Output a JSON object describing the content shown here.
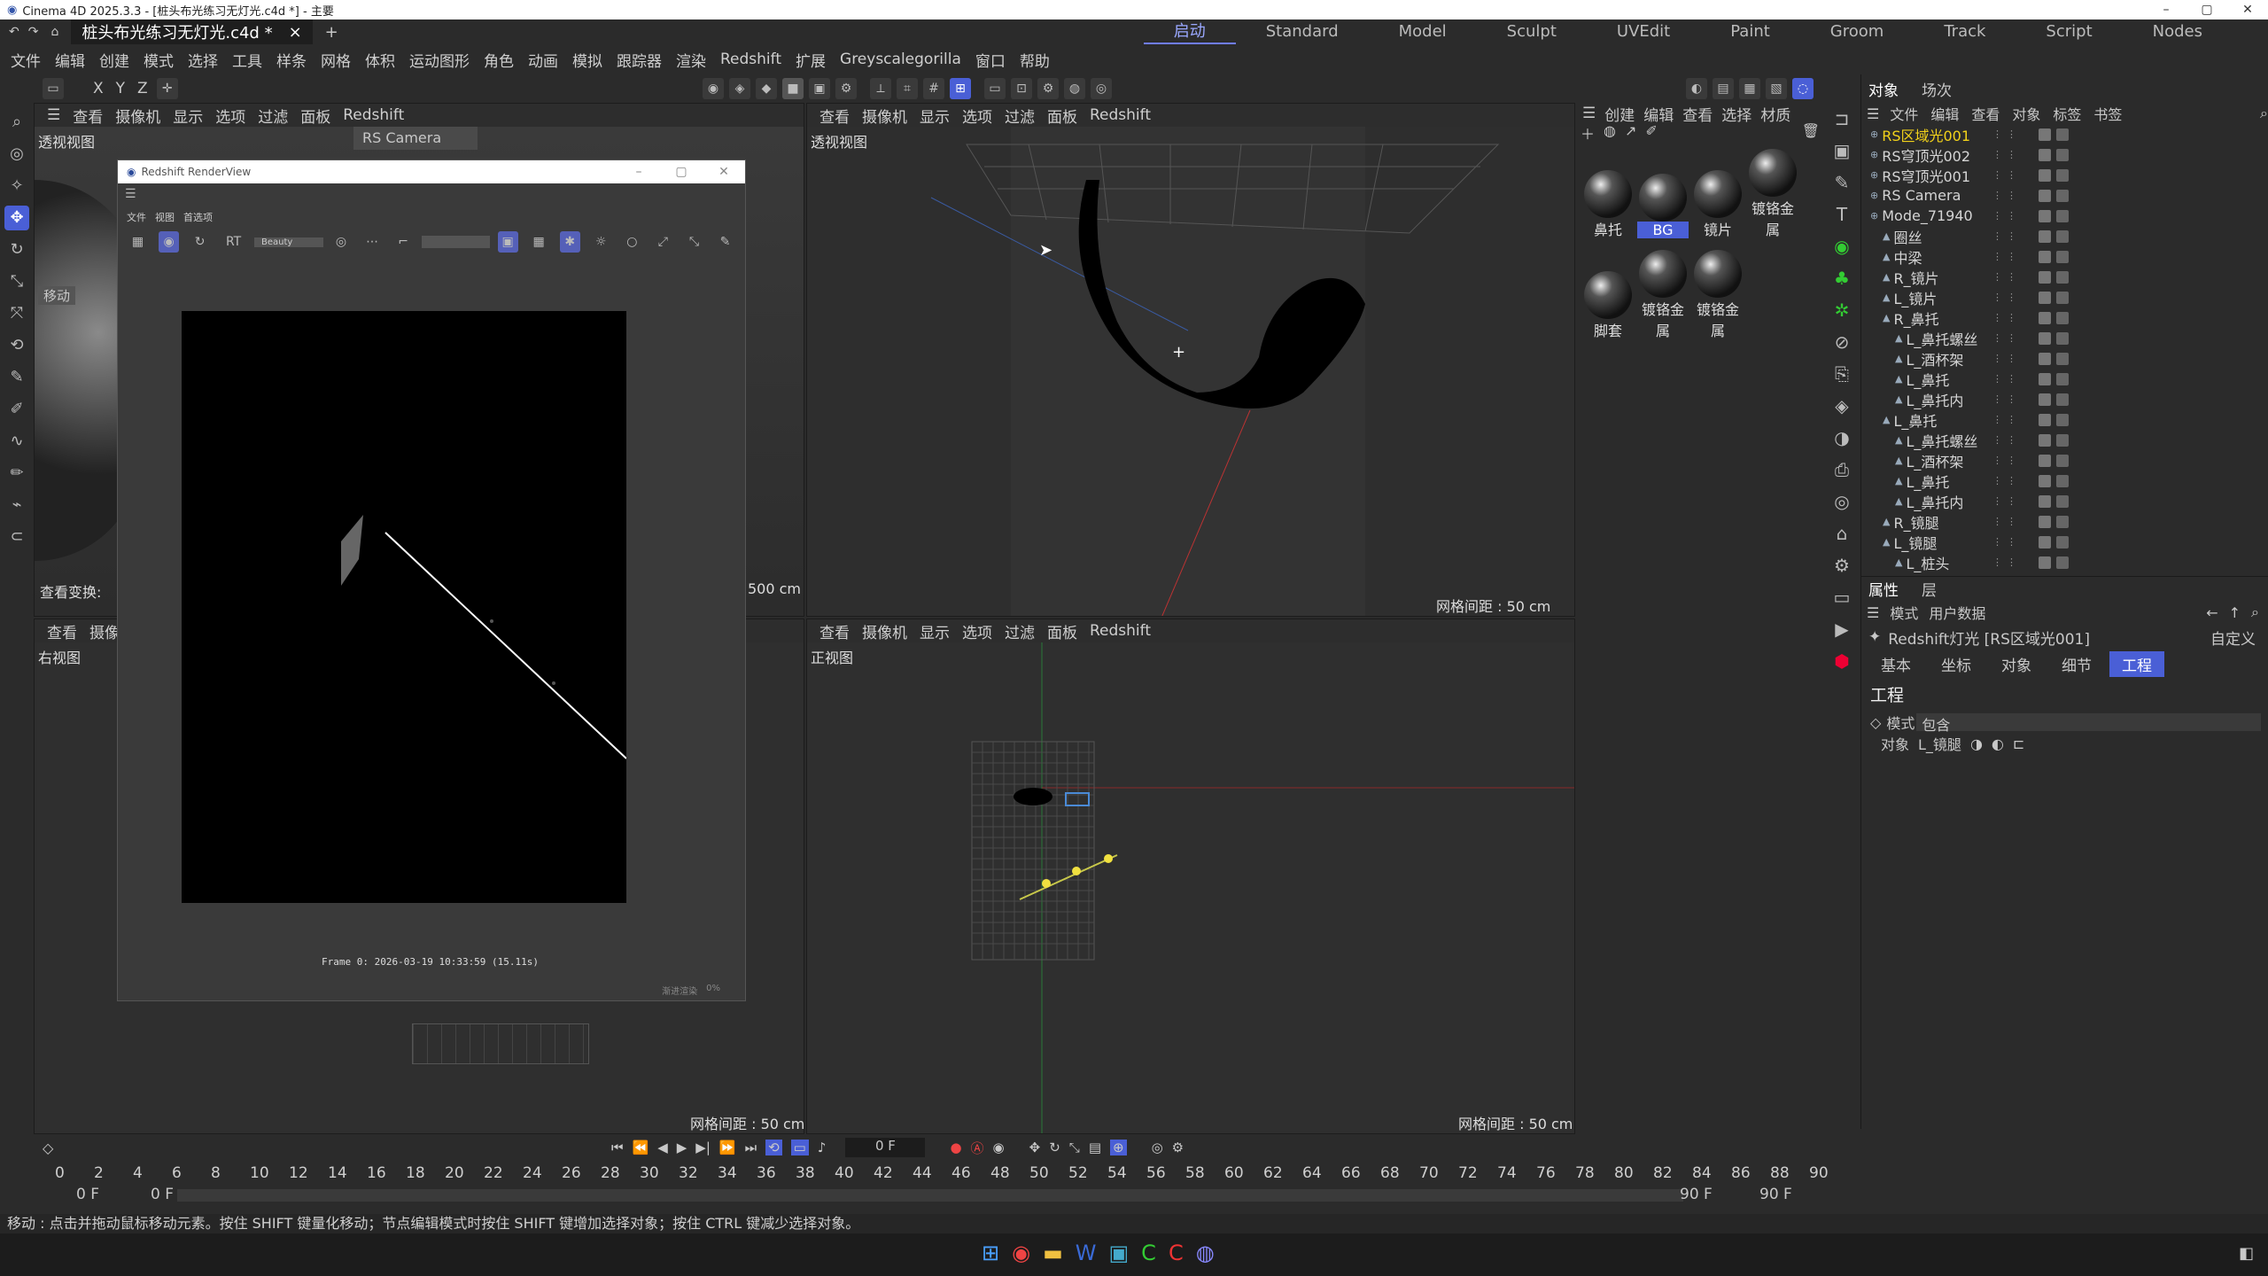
{
  "window": {
    "title": "Cinema 4D 2025.3.3 - [桩头布光练习无灯光.c4d *] - 主要"
  },
  "doc_tab": {
    "name": "桩头布光练习无灯光.c4d *",
    "close": "×",
    "add": "+"
  },
  "layouts": [
    "启动",
    "Standard",
    "Model",
    "Sculpt",
    "UVEdit",
    "Paint",
    "Groom",
    "Track",
    "Script",
    "Nodes"
  ],
  "active_layout": "启动",
  "menu": [
    "文件",
    "编辑",
    "创建",
    "模式",
    "选择",
    "工具",
    "样条",
    "网格",
    "体积",
    "运动图形",
    "角色",
    "动画",
    "模拟",
    "跟踪器",
    "渲染",
    "Redshift",
    "扩展",
    "Greyscalegorilla",
    "窗口",
    "帮助"
  ],
  "toolbar_axes": [
    "X",
    "Y",
    "Z"
  ],
  "viewport_menu": [
    "查看",
    "摄像机",
    "显示",
    "选项",
    "过滤",
    "面板",
    "Redshift"
  ],
  "viewports": {
    "tl": {
      "label": "透视视图",
      "camera": "RS Camera",
      "grid": "500 cm",
      "note": "查看变换:"
    },
    "tr": {
      "label": "透视视图",
      "grid": "网格间距 : 50 cm"
    },
    "bl": {
      "label": "右视图",
      "menu_left": "查看",
      "menu_left2": "摄像",
      "grid": "网格间距 : 50 cm"
    },
    "br": {
      "label": "正视图",
      "grid": "网格间距 : 50 cm"
    },
    "move_label": "移动"
  },
  "render_view": {
    "title": "Redshift RenderView",
    "menu": [
      "文件",
      "视图",
      "首选项"
    ],
    "aov": "Beauty",
    "status": "Frame  0:  2026-03-19  10:33:59  (15.11s)",
    "bottom": "渐进渲染",
    "bottom_pct": "0%"
  },
  "material_panel": {
    "menu": [
      "创建",
      "编辑",
      "查看",
      "选择",
      "材质"
    ],
    "materials": [
      "鼻托",
      "BG",
      "镜片",
      "镀铬金属",
      "脚套",
      "镀铬金属",
      "镀铬金属"
    ]
  },
  "objects_panel": {
    "tabs": [
      "对象",
      "场次"
    ],
    "menu": [
      "文件",
      "编辑",
      "查看",
      "对象",
      "标签",
      "书签"
    ],
    "rows": [
      {
        "name": "RS区域光001",
        "indent": 0,
        "selected": true
      },
      {
        "name": "RS穹顶光002",
        "indent": 0
      },
      {
        "name": "RS穹顶光001",
        "indent": 0
      },
      {
        "name": "RS Camera",
        "indent": 0
      },
      {
        "name": "Mode_71940",
        "indent": 0
      },
      {
        "name": "圈丝",
        "indent": 1
      },
      {
        "name": "中梁",
        "indent": 1
      },
      {
        "name": "R_镜片",
        "indent": 1
      },
      {
        "name": "L_镜片",
        "indent": 1
      },
      {
        "name": "R_鼻托",
        "indent": 1
      },
      {
        "name": "L_鼻托螺丝",
        "indent": 2
      },
      {
        "name": "L_酒杯架",
        "indent": 2
      },
      {
        "name": "L_鼻托",
        "indent": 2
      },
      {
        "name": "L_鼻托内",
        "indent": 2
      },
      {
        "name": "L_鼻托",
        "indent": 1
      },
      {
        "name": "L_鼻托螺丝",
        "indent": 2
      },
      {
        "name": "L_酒杯架",
        "indent": 2
      },
      {
        "name": "L_鼻托",
        "indent": 2
      },
      {
        "name": "L_鼻托内",
        "indent": 2
      },
      {
        "name": "R_镜腿",
        "indent": 1
      },
      {
        "name": "L_镜腿",
        "indent": 1
      },
      {
        "name": "L_桩头",
        "indent": 2
      }
    ]
  },
  "attributes": {
    "tabs": [
      "属性",
      "层"
    ],
    "menu": [
      "模式",
      "用户数据"
    ],
    "object": "Redshift灯光 [RS区域光001]",
    "preset": "自定义",
    "subtabs": [
      "基本",
      "坐标",
      "对象",
      "细节",
      "工程"
    ],
    "active_subtab": "工程",
    "section": "工程",
    "mode_label": "模式",
    "mode_value": "包含",
    "objects_label": "对象",
    "objects_value": "L_镜腿"
  },
  "timeline": {
    "current_frame": "0 F",
    "start": "0 F",
    "start2": "0 F",
    "end": "90 F",
    "end2": "90 F",
    "ticks": [
      "0",
      "2",
      "4",
      "6",
      "8",
      "10",
      "12",
      "14",
      "16",
      "18",
      "20",
      "22",
      "24",
      "26",
      "28",
      "30",
      "32",
      "34",
      "36",
      "38",
      "40",
      "42",
      "44",
      "46",
      "48",
      "50",
      "52",
      "54",
      "56",
      "58",
      "60",
      "62",
      "64",
      "66",
      "68",
      "70",
      "72",
      "74",
      "76",
      "78",
      "80",
      "82",
      "84",
      "86",
      "88",
      "90"
    ]
  },
  "status": "移动 : 点击并拖动鼠标移动元素。按住 SHIFT 键量化移动；节点编辑模式时按住 SHIFT 键增加选择对象；按住 CTRL 键减少选择对象。",
  "colors": {
    "accent": "#4a5fd6",
    "selected_text": "#f2d21a",
    "bg": "#2b2b2b"
  }
}
